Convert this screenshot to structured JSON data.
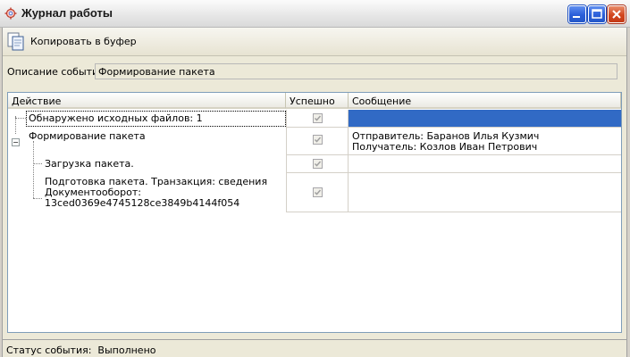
{
  "window": {
    "title": "Журнал работы",
    "icon": "gear-icon",
    "buttons": [
      "minimize-icon",
      "maximize-icon",
      "close-icon"
    ]
  },
  "toolbar": {
    "copy_label": "Копировать в буфер",
    "copy_icon": "clipboard-copy-icon"
  },
  "event": {
    "description_label": "Описание события",
    "description_value": "Формирование пакета"
  },
  "grid": {
    "columns": [
      "Действие",
      "Успешно",
      "Сообщение"
    ],
    "rows": [
      {
        "action": "Обнаружено исходных файлов: 1",
        "success": true,
        "message": "",
        "selected": true
      },
      {
        "action": "Формирование пакета",
        "success": true,
        "message_lines": [
          "Отправитель: Баранов Илья Кузмич",
          "Получатель: Козлов Иван Петрович"
        ],
        "expanded": true
      },
      {
        "action": "Загрузка пакета.",
        "success": true,
        "message": ""
      },
      {
        "action_lines": [
          "Подготовка пакета. Транзакция: сведения",
          "Документооборот:",
          "13ced0369e4745128ce3849b4144f054"
        ],
        "success": true,
        "message": ""
      }
    ]
  },
  "status": {
    "label": "Статус события:",
    "value": "Выполнено"
  },
  "colors": {
    "selection": "#316ac5",
    "window_bg": "#ece9d8",
    "grid_border": "#7f9db9"
  }
}
